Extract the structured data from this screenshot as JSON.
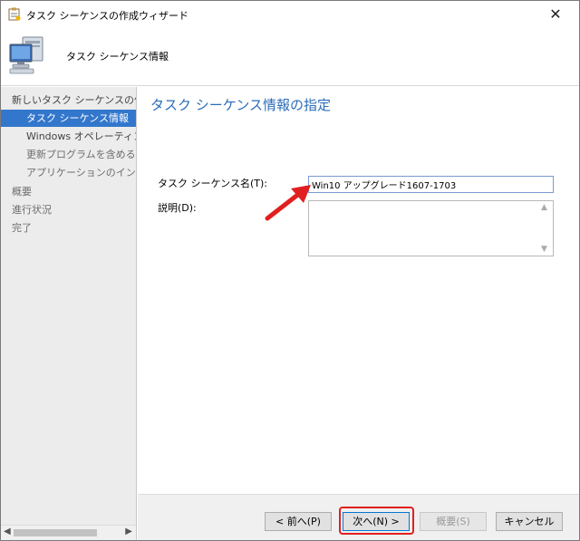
{
  "window": {
    "title": "タスク シーケンスの作成ウィザード",
    "close_glyph": "✕"
  },
  "header": {
    "title": "タスク シーケンス情報",
    "icon": "computer-icon"
  },
  "nav": {
    "items": [
      {
        "label": "新しいタスク シーケンスの作成",
        "level": "top",
        "state": "normal"
      },
      {
        "label": "タスク シーケンス情報",
        "level": "sub",
        "state": "selected"
      },
      {
        "label": "Windows オペレーティング シ",
        "level": "sub",
        "state": "normal"
      },
      {
        "label": "更新プログラムを含める",
        "level": "sub",
        "state": "dim"
      },
      {
        "label": "アプリケーションのインストール",
        "level": "sub",
        "state": "dim"
      },
      {
        "label": "概要",
        "level": "top",
        "state": "dim"
      },
      {
        "label": "進行状況",
        "level": "top",
        "state": "dim"
      },
      {
        "label": "完了",
        "level": "top",
        "state": "dim"
      }
    ],
    "scroll_left": "◀",
    "scroll_right": "▶"
  },
  "content": {
    "title": "タスク シーケンス情報の指定",
    "name_label": "タスク シーケンス名(T):",
    "name_value": "Win10 アップグレード1607-1703",
    "desc_label": "説明(D):",
    "desc_value": ""
  },
  "footer": {
    "back_label": "< 前へ(P)",
    "next_label": "次へ(N) >",
    "summary_label": "概要(S)",
    "cancel_label": "キャンセル"
  },
  "colors": {
    "accent": "#3377cc",
    "title_blue": "#2b6db8",
    "annotation_red": "#e02020"
  }
}
